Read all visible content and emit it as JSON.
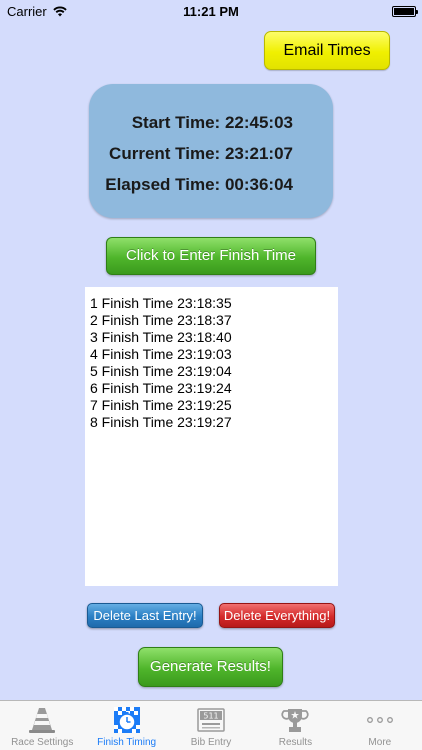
{
  "status": {
    "carrier": "Carrier",
    "time": "11:21 PM"
  },
  "email_button": "Email Times",
  "times": {
    "start_label": "Start Time:",
    "start_value": "22:45:03",
    "current_label": "Current Time:",
    "current_value": "23:21:07",
    "elapsed_label": "Elapsed Time:",
    "elapsed_value": "00:36:04"
  },
  "enter_button": "Click to Enter Finish Time",
  "entries": [
    "1 Finish Time 23:18:35",
    "2 Finish Time 23:18:37",
    "3 Finish Time 23:18:40",
    "4 Finish Time 23:19:03",
    "5 Finish Time 23:19:04",
    "6 Finish Time 23:19:24",
    "7 Finish Time 23:19:25",
    "8 Finish Time 23:19:27"
  ],
  "delete_last_button": "Delete Last Entry!",
  "delete_all_button": "Delete Everything!",
  "generate_button": "Generate Results!",
  "tabs": [
    {
      "label": "Race Settings",
      "icon": "traffic-cone-icon"
    },
    {
      "label": "Finish Timing",
      "icon": "stopwatch-flag-icon"
    },
    {
      "label": "Bib Entry",
      "icon": "bib-number-icon"
    },
    {
      "label": "Results",
      "icon": "trophy-icon"
    },
    {
      "label": "More",
      "icon": "more-dots-icon"
    }
  ],
  "colors": {
    "background": "#d4dcfc",
    "active_tab": "#1b7cf7",
    "inactive_tab": "#929292"
  }
}
